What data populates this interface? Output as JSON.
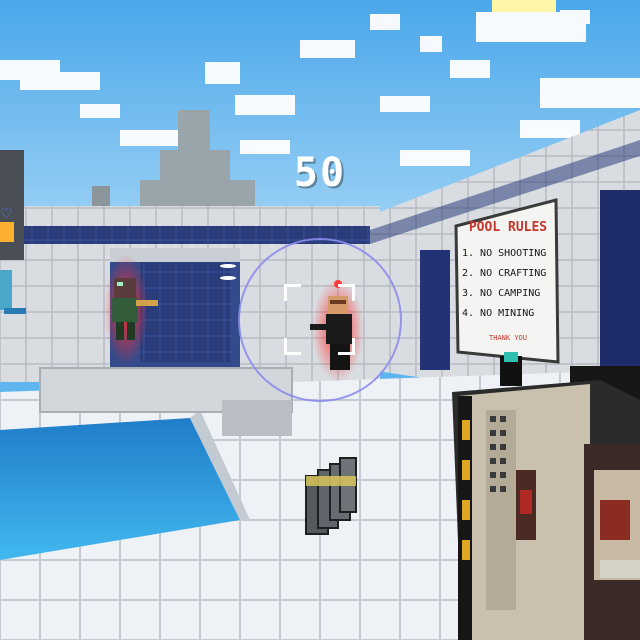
{
  "hud": {
    "countdown": "50",
    "heart_icon": "heart-icon"
  },
  "sign": {
    "title": "POOL RULES",
    "rules": [
      "1. NO SHOOTING",
      "2. NO CRAFTING",
      "3. NO CAMPING",
      "4. NO MINING"
    ],
    "footer": "THANK YOU"
  },
  "colors": {
    "sky": "#5fb6ee",
    "water": "#2c8fd6",
    "enemy_glow": "#ff2020",
    "reticle": "#8c8ceb",
    "sign_title": "#c8342c"
  }
}
